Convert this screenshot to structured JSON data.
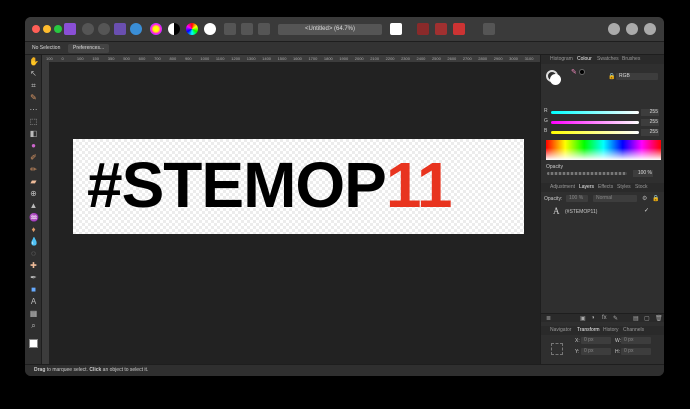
{
  "app": {
    "document_title": "<Untitled> (64.7%)"
  },
  "context_toolbar": {
    "selection_label": "No Selection",
    "preferences_button": "Preferences..."
  },
  "ruler": {
    "ticks": [
      "100",
      "0",
      "100",
      "150",
      "350",
      "500",
      "600",
      "700",
      "800",
      "900",
      "1000",
      "1100",
      "1200",
      "1300",
      "1400",
      "1500",
      "1600",
      "1700",
      "1800",
      "1900",
      "2000",
      "2100",
      "2200",
      "2300",
      "2400",
      "2500",
      "2600",
      "2700",
      "2800",
      "2900",
      "3000",
      "3100"
    ]
  },
  "canvas": {
    "text_black": "#STEMOP",
    "text_red": "11",
    "text_red_color": "#e8341f"
  },
  "status_bar": {
    "drag": "Drag",
    "text1": " to marquee select. ",
    "click": "Click",
    "text2": " an object to select it."
  },
  "colour_panel": {
    "tabs": [
      "Histogram",
      "Colour",
      "Swatches",
      "Brushes"
    ],
    "active_tab": "Colour",
    "model": "RGB",
    "channels": [
      {
        "label": "R",
        "value": "255"
      },
      {
        "label": "G",
        "value": "255"
      },
      {
        "label": "B",
        "value": "255"
      }
    ],
    "opacity_label": "Opacity",
    "opacity_value": "100 %"
  },
  "layers_panel": {
    "tabs": [
      "Adjustment",
      "Layers",
      "Effects",
      "Styles",
      "Stock"
    ],
    "active_tab": "Layers",
    "opacity_label": "Opacity:",
    "opacity_value": "100 %",
    "blend_mode": "Normal",
    "layers": [
      {
        "icon": "A",
        "name": "(#STEMOP11)"
      }
    ]
  },
  "transform_panel": {
    "tabs": [
      "Navigator",
      "Transform",
      "History",
      "Channels"
    ],
    "active_tab": "Transform",
    "fields": [
      {
        "label": "X:",
        "value": "0 px"
      },
      {
        "label": "W:",
        "value": "0 px"
      },
      {
        "label": "Y:",
        "value": "0 px"
      },
      {
        "label": "H:",
        "value": "0 px"
      },
      {
        "label": "R:",
        "value": "0 °"
      },
      {
        "label": "S:",
        "value": "0 °"
      }
    ]
  },
  "colors": {
    "close": "#ff5f57",
    "minimize": "#febc2e",
    "zoom": "#28c840",
    "accent": "#8a4fd6"
  }
}
